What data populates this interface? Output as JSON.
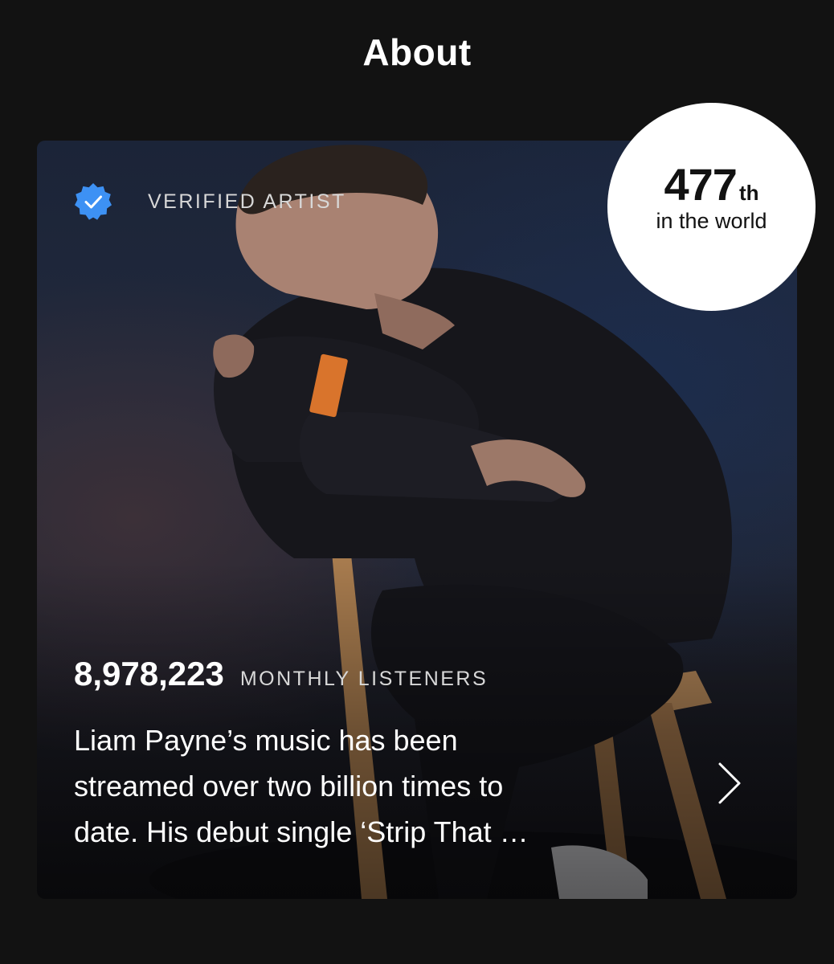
{
  "header": {
    "title": "About"
  },
  "card": {
    "verified_label": "VERIFIED ARTIST",
    "rank": {
      "number": "477",
      "suffix": "th",
      "caption": "in the world"
    },
    "monthly_listeners": {
      "count": "8,978,223",
      "label": "MONTHLY LISTENERS"
    },
    "bio_lines": [
      "Liam Payne’s music has been",
      "streamed over two billion times to",
      "date. His debut single ‘Strip That …"
    ]
  },
  "colors": {
    "background": "#121212",
    "verified_blue": "#3d91f4",
    "text_primary": "#ffffff",
    "text_secondary": "#d8d8d8"
  },
  "icons": {
    "verified": "verified-badge-icon",
    "next": "chevron-right-icon"
  }
}
